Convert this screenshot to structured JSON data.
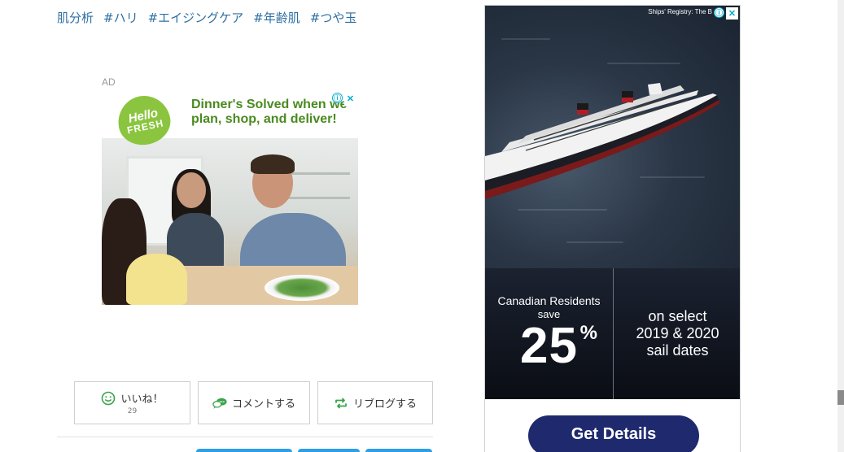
{
  "hashtags": [
    "肌分析",
    "#ハリ",
    "#エイジングケア",
    "#年齢肌",
    "#つや玉"
  ],
  "ad_label": "AD",
  "hellofresh_ad": {
    "logo_line1": "Hello",
    "logo_line2": "FRESH",
    "headline": "Dinner's Solved when we plan, shop, and deliver!",
    "info_icon": "ⓘ",
    "close_icon": "✕"
  },
  "actions": {
    "like_label": "いいね！",
    "like_count": "29",
    "comment_label": "コメントする",
    "reblog_label": "リブログする"
  },
  "cruise_ad": {
    "registry": "Ships' Registry: The B",
    "info_icon": "ⓘ",
    "close_icon": "✕",
    "left_line1": "Canadian Residents",
    "left_line2": "save",
    "percent": "25",
    "percent_symbol": "%",
    "right_line1": "on select",
    "right_line2": "2019 & 2020",
    "right_line3": "sail dates",
    "cta": "Get Details"
  },
  "colors": {
    "hashtag": "#2d6fa3",
    "hellofresh_green": "#8bc540",
    "cta_navy": "#1f2a6e",
    "like_green": "#3aa34a"
  }
}
